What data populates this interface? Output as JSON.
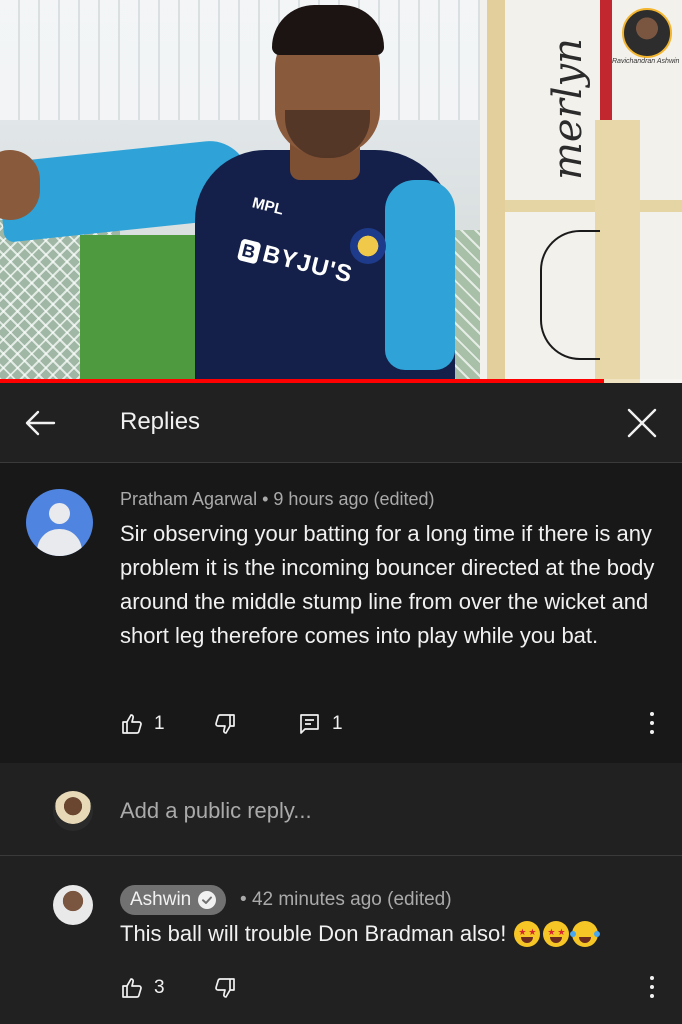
{
  "video": {
    "progress_fraction": 0.885,
    "jersey_sponsor": "BYJU'S",
    "jersey_brand": "MPL",
    "channel_tag": "Ravichandran Ashwin"
  },
  "header": {
    "title": "Replies"
  },
  "comment": {
    "author": "Pratham Agarwal",
    "separator": "•",
    "time": "9 hours ago (edited)",
    "body": "Sir observing your batting for a long time if there is any problem it is the incoming bouncer directed at the body around the middle stump line from over the wicket and short leg therefore comes into play while you bat.",
    "likes": "1",
    "replies": "1"
  },
  "reply_input": {
    "placeholder": "Add a public reply..."
  },
  "reply": {
    "author": "Ashwin",
    "separator": "•",
    "time": "42 minutes ago (edited)",
    "body": "This ball will trouble Don Bradman also!",
    "likes": "3"
  },
  "colors": {
    "background": "#212121",
    "comment_background": "#181818",
    "secondary_text": "#aaaaaa",
    "progress": "#ff0000",
    "avatar_blue": "#4f84e0"
  }
}
